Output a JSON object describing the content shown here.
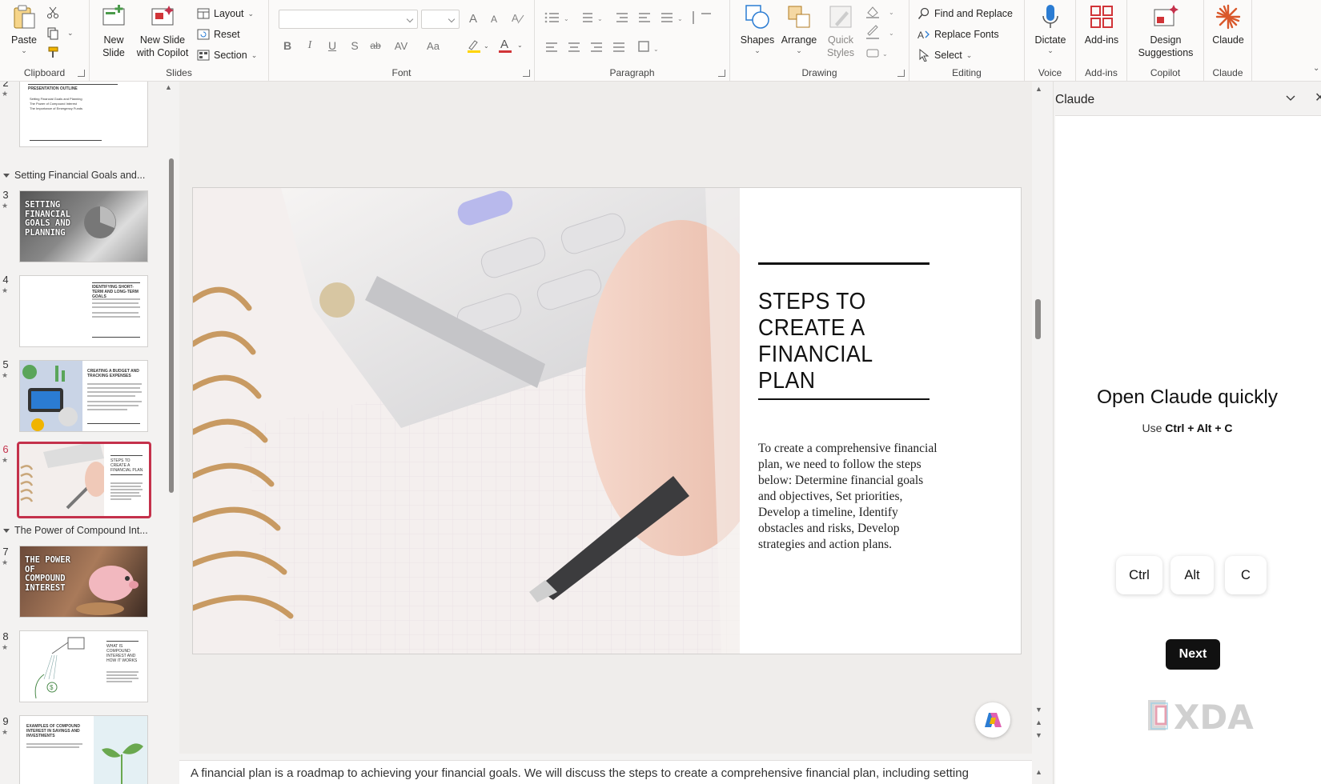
{
  "ribbon": {
    "groups": {
      "clipboard": "Clipboard",
      "slides": "Slides",
      "font": "Font",
      "paragraph": "Paragraph",
      "drawing": "Drawing",
      "editing": "Editing",
      "voice": "Voice",
      "addins": "Add-ins",
      "copilot": "Copilot",
      "claude": "Claude"
    },
    "paste": "Paste",
    "new_slide": [
      "New",
      "Slide"
    ],
    "new_slide_copilot": [
      "New Slide",
      "with Copilot"
    ],
    "layout": "Layout",
    "reset": "Reset",
    "section": "Section",
    "shapes": "Shapes",
    "arrange": "Arrange",
    "quick_styles": [
      "Quick",
      "Styles"
    ],
    "find_replace": "Find and Replace",
    "replace_fonts": "Replace Fonts",
    "select": "Select",
    "dictate": "Dictate",
    "addins": "Add-ins",
    "design_suggestions": [
      "Design",
      "Suggestions"
    ],
    "claude": "Claude",
    "font_glyphs": {
      "bold": "B",
      "italic": "I",
      "underline": "U",
      "strike": "S",
      "shadow": "ab",
      "spacing": "AV",
      "case": "Aa",
      "grow": "A",
      "shrink": "A",
      "fontcolor": "A"
    },
    "colors": {
      "accent": "#c4314b",
      "highlight": "#ffd400",
      "font_color": "#d13438"
    }
  },
  "thumbnails": {
    "sections": [
      {
        "label": "Setting Financial Goals and..."
      },
      {
        "label": "The Power of Compound Int..."
      }
    ],
    "slide_numbers": [
      "2",
      "3",
      "4",
      "5",
      "6",
      "7",
      "8",
      "9"
    ],
    "star": "★",
    "slide2": {
      "title": "PRESENTATION OUTLINE",
      "bullets": [
        "Setting Financial Goals and Planning",
        "The Power of Compound Interest",
        "The Importance of Emergency Funds"
      ]
    },
    "slide3": {
      "title": "SETTING FINANCIAL GOALS AND PLANNING"
    },
    "slide4": {
      "title": "IDENTIFYING SHORT-TERM AND LONG-TERM GOALS"
    },
    "slide5": {
      "title": "CREATING A BUDGET AND TRACKING EXPENSES"
    },
    "slide6": {
      "title": "STEPS TO CREATE A FINANCIAL PLAN"
    },
    "slide7": {
      "title": "THE POWER OF COMPOUND INTEREST"
    },
    "slide8": {
      "title": "WHAT IS COMPOUND INTEREST AND HOW IT WORKS"
    },
    "slide9": {
      "title": "EXAMPLES OF COMPOUND INTEREST IN SAVINGS AND INVESTMENTS"
    }
  },
  "slide": {
    "title": "STEPS TO CREATE A FINANCIAL PLAN",
    "body": "To create a comprehensive financial plan, we need to follow the steps below: Determine financial goals and objectives, Set priorities, Develop a timeline, Identify obstacles and risks, Develop strategies and action plans."
  },
  "notes": {
    "text": "A financial plan is a roadmap to achieving your financial goals. We will discuss the steps to create a comprehensive financial plan, including setting"
  },
  "claude_pane": {
    "title": "Claude",
    "close": "✕",
    "heading": "Open Claude quickly",
    "sub_prefix": "Use",
    "shortcut": "Ctrl + Alt + C",
    "keys": [
      "Ctrl",
      "Alt",
      "C"
    ],
    "next": "Next",
    "watermark": "XDA"
  }
}
